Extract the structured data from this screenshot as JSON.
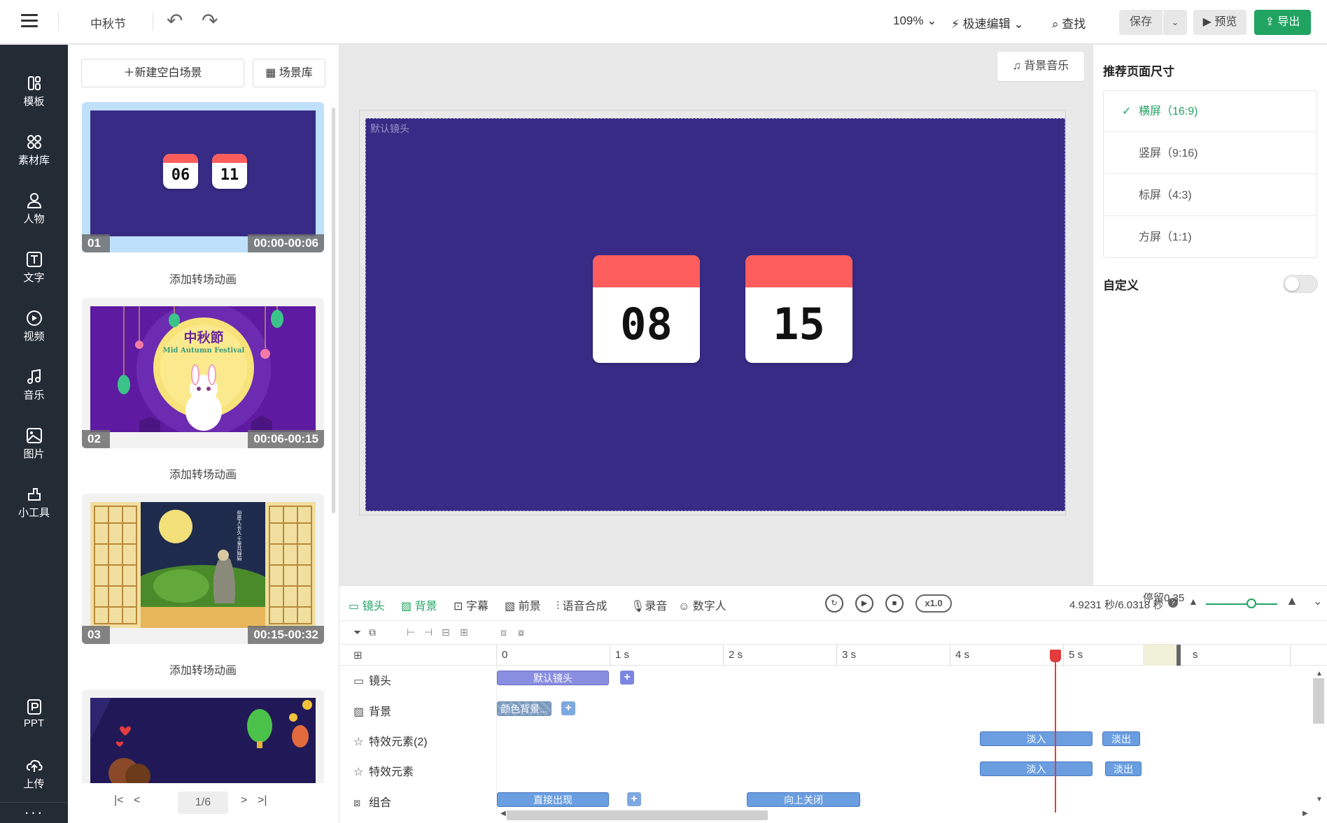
{
  "topbar": {
    "title": "中秋节",
    "zoom": "109% ⌄",
    "fast_edit": "极速编辑 ⌄",
    "find": "查找",
    "save": "保存",
    "preview": "预览",
    "export": "导出"
  },
  "leftnav": {
    "items": [
      {
        "label": "模板",
        "icon": "template-icon"
      },
      {
        "label": "素材库",
        "icon": "material-library-icon"
      },
      {
        "label": "人物",
        "icon": "person-icon"
      },
      {
        "label": "文字",
        "icon": "text-icon"
      },
      {
        "label": "视频",
        "icon": "video-icon"
      },
      {
        "label": "音乐",
        "icon": "music-icon"
      },
      {
        "label": "图片",
        "icon": "image-icon"
      },
      {
        "label": "小工具",
        "icon": "tools-icon"
      }
    ],
    "bottom": [
      {
        "label": "PPT",
        "icon": "ppt-icon"
      },
      {
        "label": "上传",
        "icon": "upload-icon"
      }
    ],
    "more": "···"
  },
  "scenes": {
    "new_blank": "新建空白场景",
    "library": "场景库",
    "items": [
      {
        "num": "01",
        "time": "00:00-00:06",
        "cal": [
          "06",
          "11"
        ]
      },
      {
        "num": "02",
        "time": "00:06-00:15",
        "title_cn": "中秋節",
        "title_en": "Mid Autumn Festival"
      },
      {
        "num": "03",
        "time": "00:15-00:32",
        "poem": "但愿人长久 千里共婵娟"
      }
    ],
    "add_transition": "添加转场动画",
    "page": "1/6"
  },
  "canvas": {
    "bgm": "背景音乐",
    "camera_label": "默认镜头",
    "cal": [
      "08",
      "15"
    ]
  },
  "rightpanel": {
    "title": "推荐页面尺寸",
    "sizes": [
      "横屏（16:9)",
      "竖屏（9:16)",
      "标屏（4:3)",
      "方屏（1:1)"
    ],
    "selected": 0,
    "custom": "自定义"
  },
  "timeline": {
    "tabs": [
      "镜头",
      "背景",
      "字幕",
      "前景",
      "语音合成",
      "录音",
      "数字人"
    ],
    "speed": "x1.0",
    "time": "4.9231 秒/6.0318 秒",
    "ticks": [
      "0",
      "1 s",
      "2 s",
      "3 s",
      "4 s",
      "5 s",
      "s"
    ],
    "pause": "停留0.35",
    "rows": [
      {
        "label": "镜头",
        "icon": "camera-icon"
      },
      {
        "label": "背景",
        "icon": "background-icon"
      },
      {
        "label": "特效元素(2)",
        "icon": "effect-icon"
      },
      {
        "label": "特效元素",
        "icon": "effect-icon"
      },
      {
        "label": "组合",
        "icon": "group-icon"
      }
    ],
    "clips": {
      "camera": "默认镜头",
      "bg": "颜色背景...",
      "fadein": "淡入",
      "fadeout": "淡出",
      "appear": "直接出现",
      "close_up": "向上关闭"
    },
    "colors": {
      "accent": "#21a362",
      "playhead": "#e23c3c"
    }
  }
}
